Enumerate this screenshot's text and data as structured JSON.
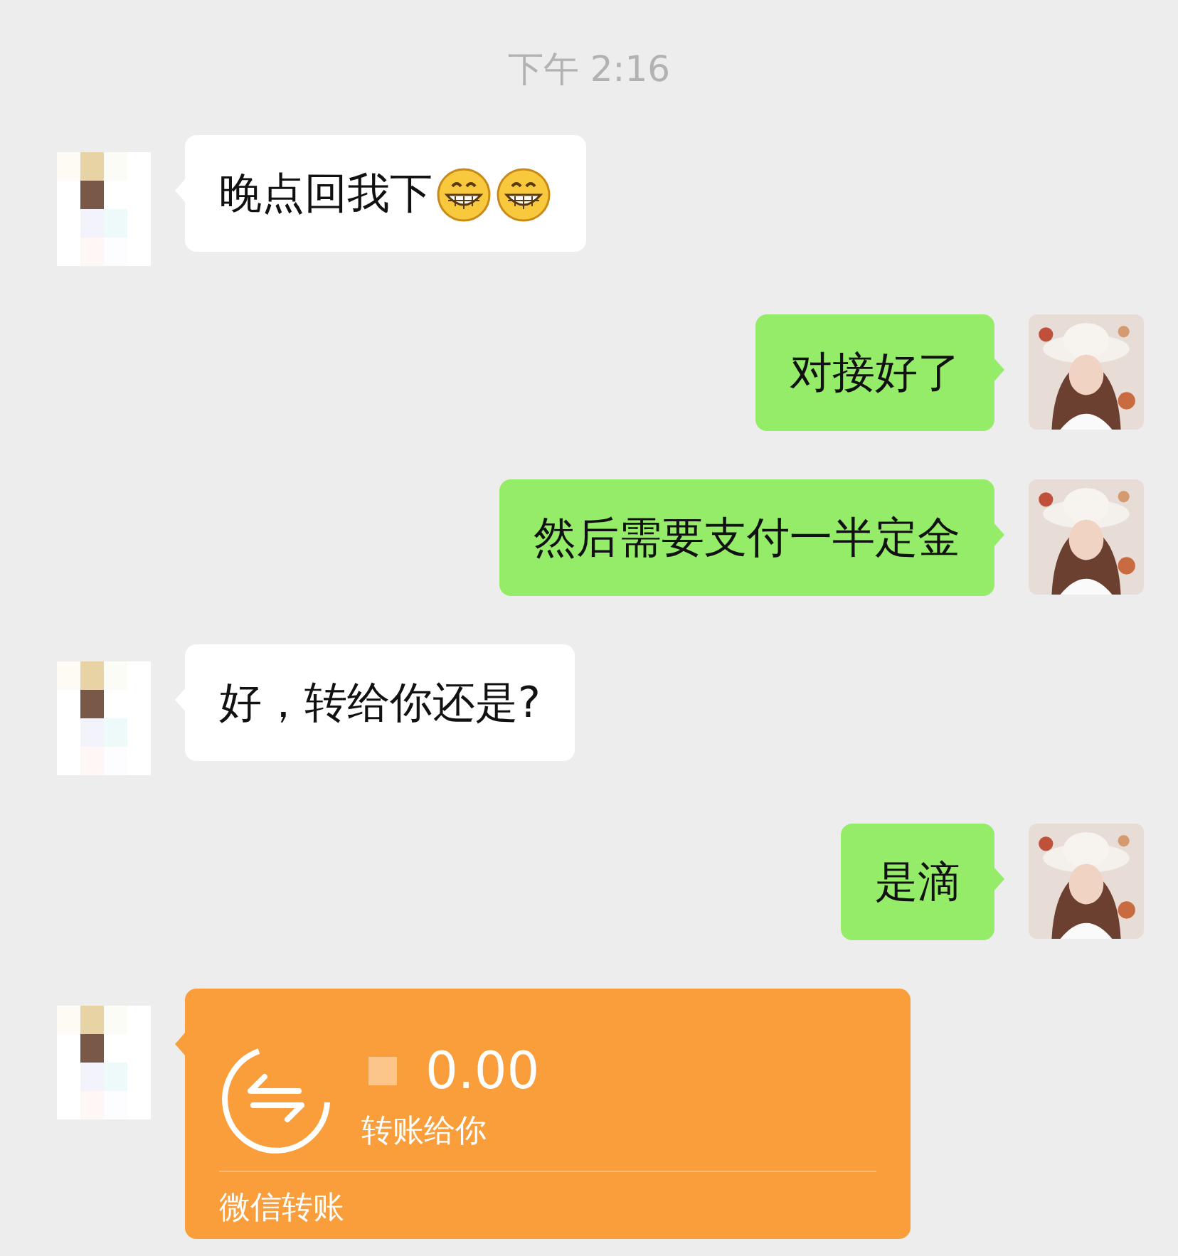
{
  "time": "下午 2:16",
  "messages": [
    {
      "outgoing": false,
      "kind": "text",
      "text": "晚点回我下",
      "emojis": [
        {
          "kind": "grin"
        },
        {
          "kind": "grin"
        }
      ]
    },
    {
      "outgoing": true,
      "kind": "text",
      "text": "对接好了"
    },
    {
      "outgoing": true,
      "kind": "text",
      "text": "然后需要支付一半定金"
    },
    {
      "outgoing": false,
      "kind": "text",
      "text": "好，转给你还是?"
    },
    {
      "outgoing": true,
      "kind": "text",
      "text": "是滴"
    },
    {
      "outgoing": false,
      "kind": "transfer",
      "amount": "0.00",
      "note": "转账给你",
      "footer": "微信转账"
    }
  ]
}
